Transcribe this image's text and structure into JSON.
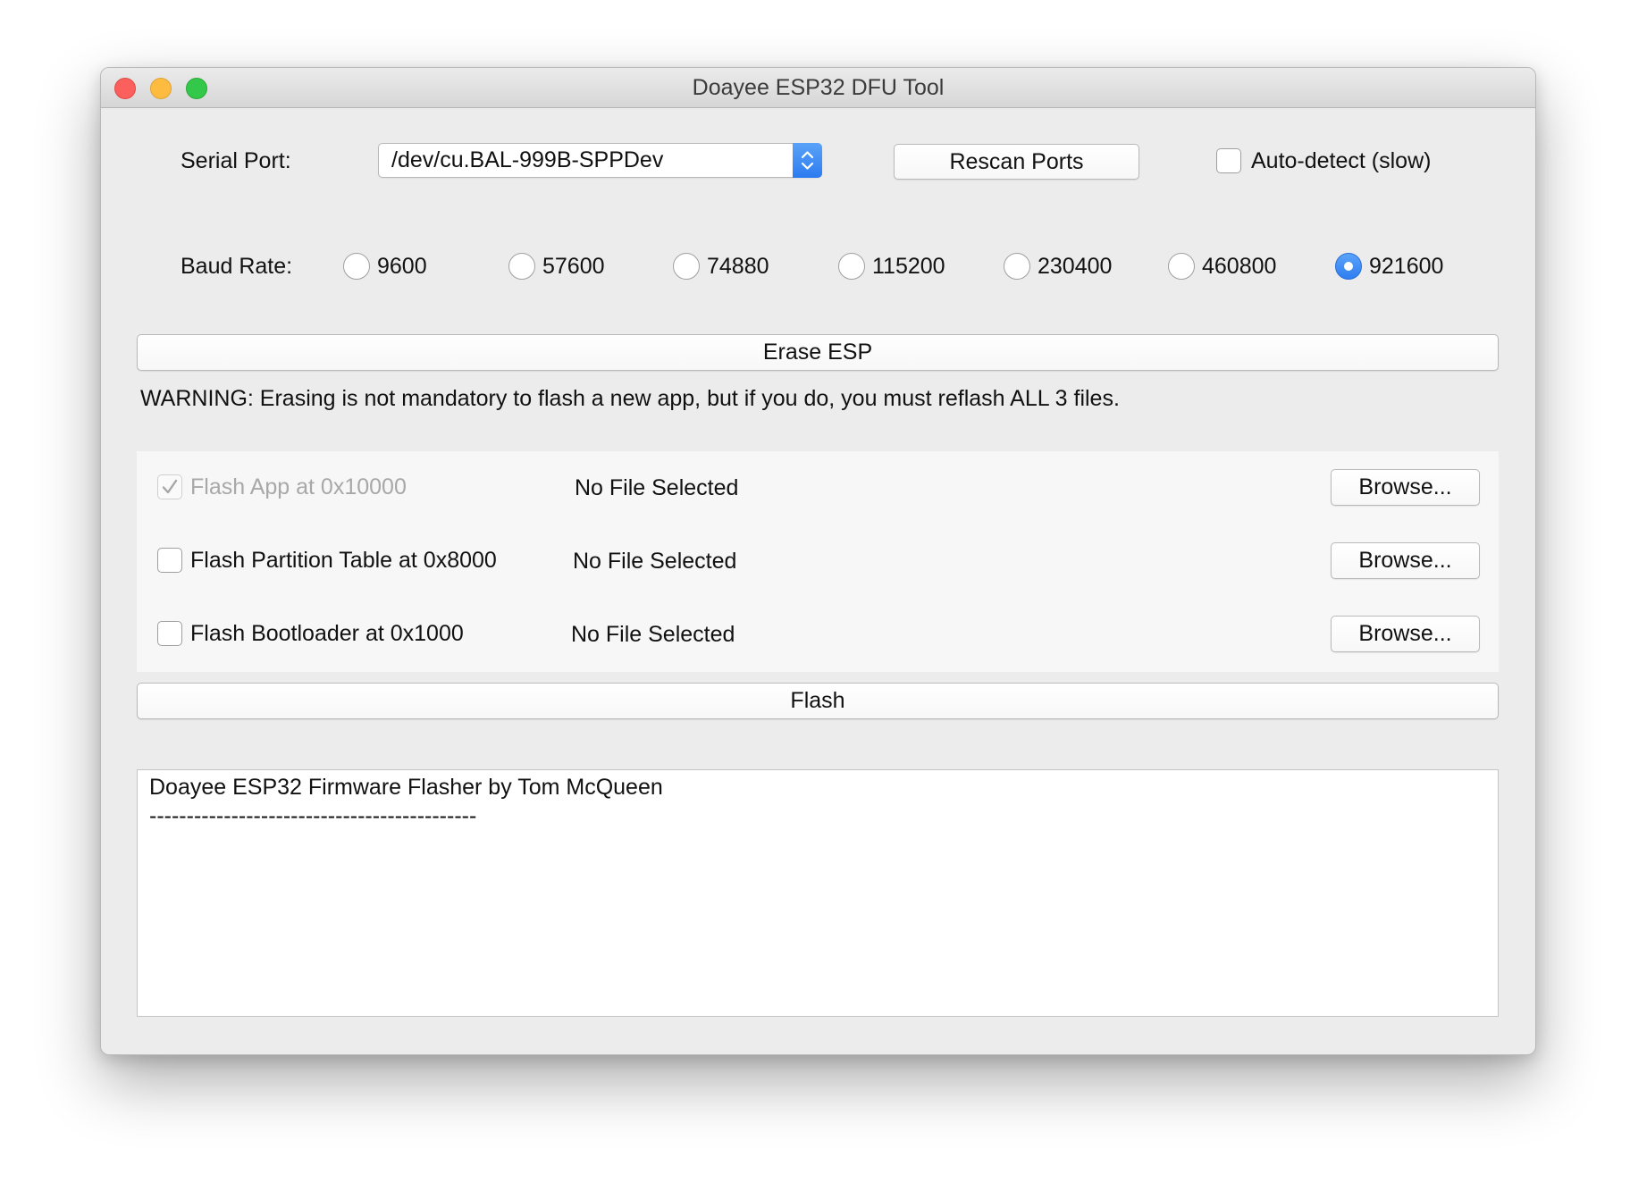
{
  "window": {
    "title": "Doayee ESP32 DFU Tool"
  },
  "serial": {
    "label": "Serial Port:",
    "selected_port": "/dev/cu.BAL-999B-SPPDev",
    "rescan_label": "Rescan Ports",
    "autodetect_label": "Auto-detect (slow)",
    "autodetect_checked": false
  },
  "baud": {
    "label": "Baud Rate:",
    "options": [
      {
        "label": "9600",
        "selected": false
      },
      {
        "label": "57600",
        "selected": false
      },
      {
        "label": "74880",
        "selected": false
      },
      {
        "label": "115200",
        "selected": false
      },
      {
        "label": "230400",
        "selected": false
      },
      {
        "label": "460800",
        "selected": false
      },
      {
        "label": "921600",
        "selected": true
      }
    ]
  },
  "erase": {
    "button_label": "Erase ESP",
    "warning": "WARNING: Erasing is not mandatory to flash a new app, but if you do, you must reflash ALL 3 files."
  },
  "files": [
    {
      "label": "Flash App at 0x10000",
      "checked": true,
      "enabled": false,
      "status": "No File Selected",
      "browse_label": "Browse..."
    },
    {
      "label": "Flash Partition Table at 0x8000",
      "checked": false,
      "enabled": true,
      "status": "No File Selected",
      "browse_label": "Browse..."
    },
    {
      "label": "Flash Bootloader at 0x1000",
      "checked": false,
      "enabled": true,
      "status": "No File Selected",
      "browse_label": "Browse..."
    }
  ],
  "flash": {
    "button_label": "Flash"
  },
  "log": {
    "lines": [
      "Doayee ESP32 Firmware Flasher by Tom McQueen",
      "--------------------------------------------"
    ]
  },
  "colors": {
    "accent": "#2f7ef1",
    "window_bg": "#ececec",
    "close": "#fc605c",
    "minimize": "#fdbc40",
    "zoom": "#34c84a"
  }
}
